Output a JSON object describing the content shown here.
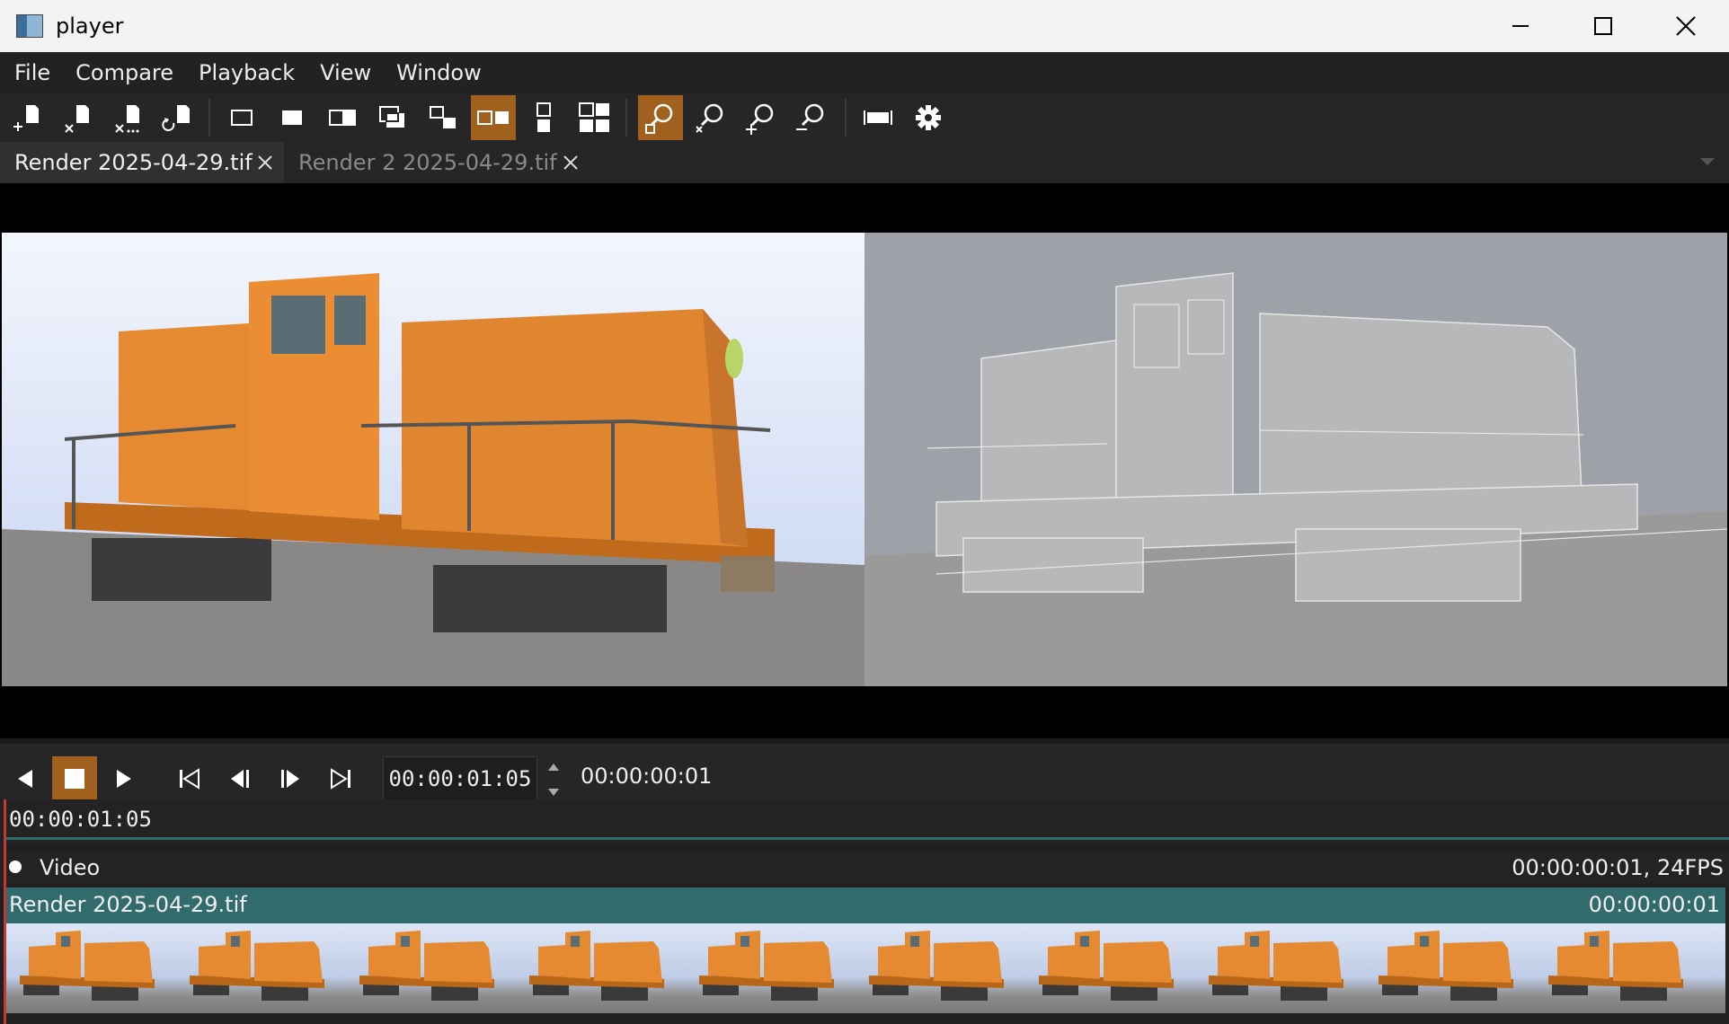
{
  "window": {
    "title": "player"
  },
  "menu": [
    "File",
    "Compare",
    "Playback",
    "View",
    "Window"
  ],
  "toolbar": {
    "file_icons": [
      "open-file-icon",
      "close-file-icon",
      "close-all-icon",
      "reload-icon"
    ],
    "compare_icons": [
      "compare-a-icon",
      "compare-b-icon",
      "compare-wipe-icon",
      "compare-overlay-icon",
      "compare-difference-icon",
      "compare-horizontal-icon",
      "compare-vertical-icon",
      "compare-tile-icon"
    ],
    "active_compare": "compare-horizontal-icon",
    "view_icons": [
      "frame-view-icon",
      "zoom-reset-icon",
      "zoom-in-icon",
      "zoom-out-icon"
    ],
    "active_view": "frame-view-icon",
    "extra_icons": [
      "timeline-icon",
      "settings-icon"
    ]
  },
  "tabs": [
    {
      "label": "Render 2025-04-29.tif",
      "active": true
    },
    {
      "label": "Render 2 2025-04-29.tif",
      "active": false
    }
  ],
  "transport": {
    "current_time": "00:00:01:05",
    "duration": "00:00:00:01"
  },
  "timeline": {
    "ruler_time": "00:00:01:05",
    "track": {
      "name": "Video",
      "info": "00:00:00:01, 24FPS"
    },
    "clip": {
      "name": "Render 2025-04-29.tif",
      "duration": "00:00:00:01"
    },
    "thumbnail_count": 10
  },
  "colors": {
    "accent": "#a0601e",
    "clip": "#326b6b",
    "playhead": "#c03a3a",
    "locomotive": "#e58a30"
  }
}
